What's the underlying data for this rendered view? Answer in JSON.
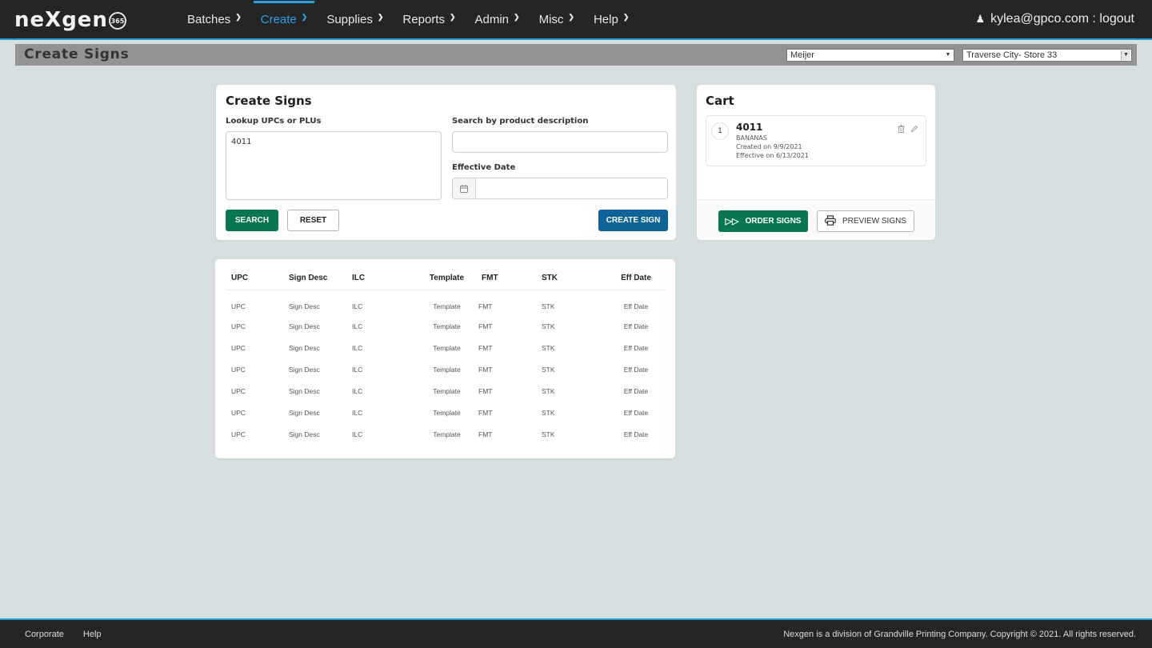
{
  "app": {
    "logo_text": "neXgen",
    "logo_badge": "365"
  },
  "nav": {
    "items": [
      {
        "label": "Batches",
        "active": false
      },
      {
        "label": "Create",
        "active": true
      },
      {
        "label": "Supplies",
        "active": false
      },
      {
        "label": "Reports",
        "active": false
      },
      {
        "label": "Admin",
        "active": false
      },
      {
        "label": "Misc",
        "active": false
      },
      {
        "label": "Help",
        "active": false
      }
    ],
    "user_label": "kylea@gpco.com : logout"
  },
  "subheader": {
    "title": "Create Signs",
    "retailer_select": "Meijer",
    "store_select": "Traverse City- Store 33"
  },
  "create_signs": {
    "title": "Create Signs",
    "lookup_label": "Lookup UPCs or PLUs",
    "lookup_value": "4011",
    "desc_label": "Search by product description",
    "desc_value": "",
    "date_label": "Effective Date",
    "date_value": "",
    "search_button": "SEARCH",
    "reset_button": "RESET",
    "create_button": "CREATE SIGN"
  },
  "cart": {
    "title": "Cart",
    "items": [
      {
        "index": "1",
        "code": "4011",
        "description": "BANANAS",
        "created": "Created on 9/9/2021",
        "effective": "Effective on 6/13/2021"
      }
    ],
    "order_button": "ORDER SIGNS",
    "preview_button": "PREVIEW SIGNS"
  },
  "results_table": {
    "columns": [
      "UPC",
      "Sign Desc",
      "ILC",
      "Template",
      "FMT",
      "STK",
      "Eff Date"
    ],
    "rows": [
      [
        "UPC",
        "Sign Desc",
        "ILC",
        "Template",
        "FMT",
        "STK",
        "Eff Date"
      ],
      [
        "UPC",
        "Sign Desc",
        "ILC",
        "Template",
        "FMT",
        "STK",
        "Eff Date"
      ],
      [
        "UPC",
        "Sign Desc",
        "ILC",
        "Template",
        "FMT",
        "STK",
        "Eff Date"
      ],
      [
        "UPC",
        "Sign Desc",
        "ILC",
        "Template",
        "FMT",
        "STK",
        "Eff Date"
      ],
      [
        "UPC",
        "Sign Desc",
        "ILC",
        "Template",
        "FMT",
        "STK",
        "Eff Date"
      ],
      [
        "UPC",
        "Sign Desc",
        "ILC",
        "Template",
        "FMT",
        "STK",
        "Eff Date"
      ],
      [
        "UPC",
        "Sign Desc",
        "ILC",
        "Template",
        "FMT",
        "STK",
        "Eff Date"
      ]
    ]
  },
  "footer": {
    "links": [
      "Corporate",
      "Help"
    ],
    "copyright": "Nexgen is a division of Grandville Printing Company. Copyright © 2021. All rights reserved."
  },
  "colors": {
    "nav_bg": "#252525",
    "accent_blue": "#2a9ad8",
    "primary_green": "#087553",
    "primary_blue": "#0e6497",
    "page_bg": "#d6dfdf",
    "subheader_bg": "#939393"
  }
}
